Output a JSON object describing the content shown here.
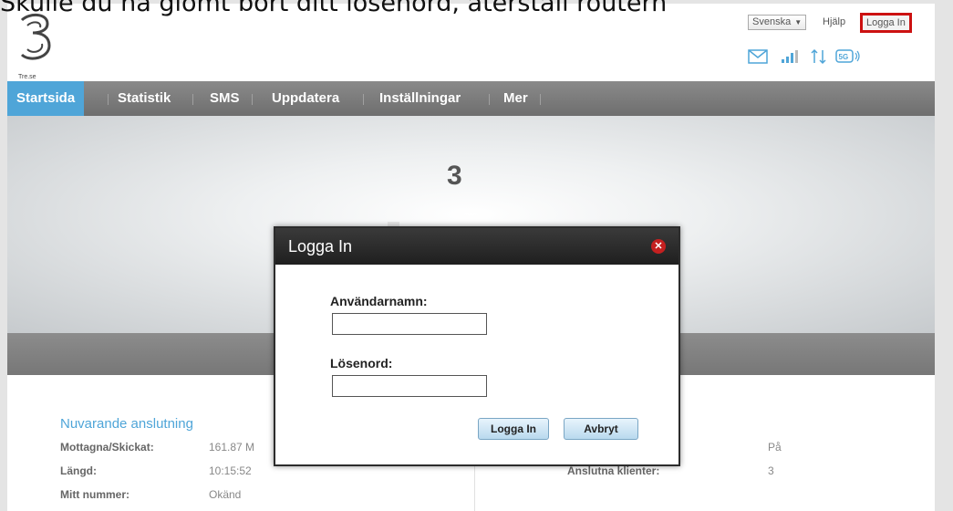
{
  "caption": "Skulle du ha glömt bort ditt lösenord, återställ routern",
  "header": {
    "logo_text": "Tre.se",
    "language": "Svenska",
    "help": "Hjälp",
    "login": "Logga In"
  },
  "status_icons": [
    "mail-icon",
    "signal-icon",
    "data-transfer-icon",
    "5g-icon"
  ],
  "nav": {
    "items": [
      {
        "label": "Startsida",
        "active": true
      },
      {
        "label": "Statistik",
        "active": false
      },
      {
        "label": "SMS",
        "active": false
      },
      {
        "label": "Uppdatera",
        "active": false
      },
      {
        "label": "Inställningar",
        "active": false
      },
      {
        "label": "Mer",
        "active": false
      }
    ]
  },
  "hero": {
    "operator": "3",
    "signal_bars": 3,
    "signal_bars_total": 4
  },
  "dialog": {
    "title": "Logga In",
    "username_label": "Användarnamn:",
    "username_value": "",
    "password_label": "Lösenord:",
    "password_value": "",
    "login_button": "Logga In",
    "cancel_button": "Avbryt"
  },
  "connection": {
    "title": "Nuvarande anslutning",
    "rows_left": [
      {
        "label": "Mottagna/Skickat:",
        "value": "161.87 M"
      },
      {
        "label": "Längd:",
        "value": "10:15:52"
      },
      {
        "label": "Mitt nummer:",
        "value": "Okänd"
      }
    ],
    "rows_right": [
      {
        "label": "",
        "value": "På"
      },
      {
        "label": "Anslutna klienter:",
        "value": "3"
      }
    ]
  },
  "colors": {
    "accent": "#4fa5d8",
    "signal_green": "#86c45a",
    "nav_bg": "#777777",
    "highlight_red": "#cc1111"
  }
}
